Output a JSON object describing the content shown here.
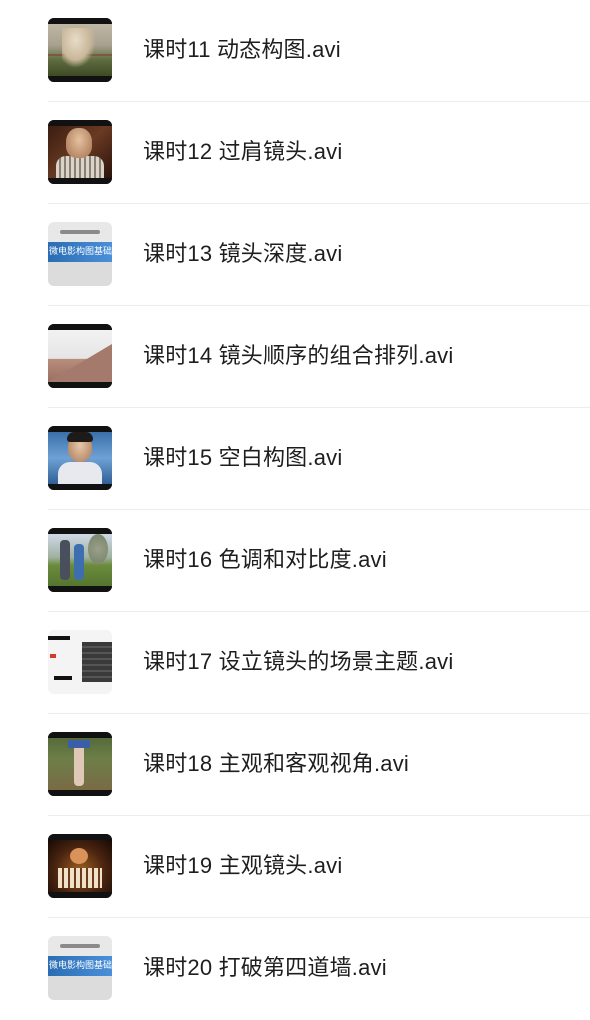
{
  "lessons": [
    {
      "title": "课时11 动态构图.avi"
    },
    {
      "title": "课时12 过肩镜头.avi"
    },
    {
      "title": "课时13 镜头深度.avi",
      "thumb_text": "微电影构图基础"
    },
    {
      "title": "课时14 镜头顺序的组合排列.avi"
    },
    {
      "title": "课时15 空白构图.avi"
    },
    {
      "title": "课时16 色调和对比度.avi"
    },
    {
      "title": "课时17 设立镜头的场景主题.avi"
    },
    {
      "title": "课时18 主观和客观视角.avi"
    },
    {
      "title": "课时19 主观镜头.avi"
    },
    {
      "title": "课时20 打破第四道墙.avi",
      "thumb_text": "微电影构图基础"
    }
  ],
  "colors": {
    "text": "#1e1e1e",
    "divider": "#ececec",
    "background": "#ffffff"
  }
}
